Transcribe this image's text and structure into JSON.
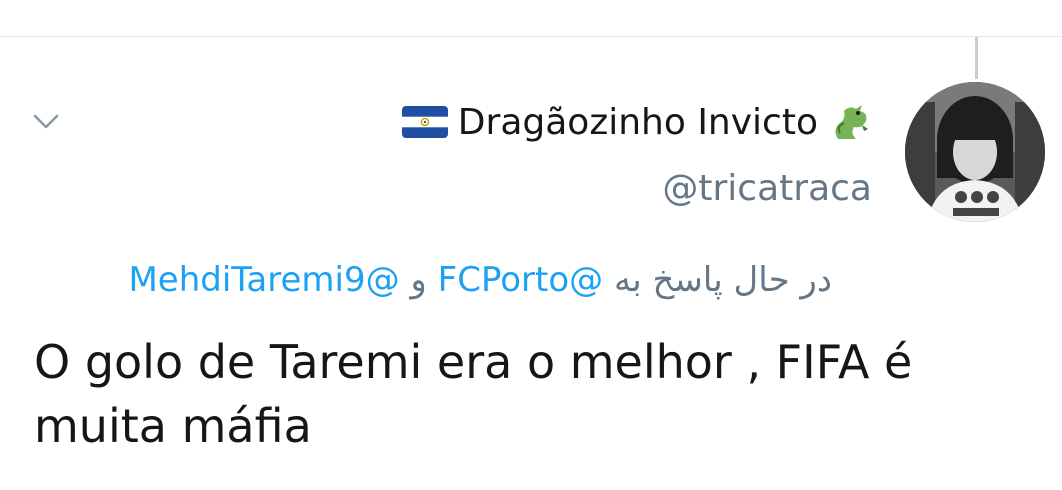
{
  "tweet": {
    "author": {
      "display_name": "Dragãozinho Invicto",
      "handle": "@tricatraca",
      "flag_icon": "el-salvador-flag-icon",
      "emoji_icon": "dragon-icon"
    },
    "reply_to": {
      "prefix": "در حال پاسخ به",
      "mention_1": "@FCPorto",
      "conjunction": "و",
      "mention_2": "@MehdiTaremi9"
    },
    "text": "O golo de Taremi era o melhor , FIFA é muita máfia"
  },
  "colors": {
    "link": "#1da1f2",
    "secondary_text": "#657786",
    "primary_text": "#14171a",
    "divider": "#e1e8ed"
  }
}
